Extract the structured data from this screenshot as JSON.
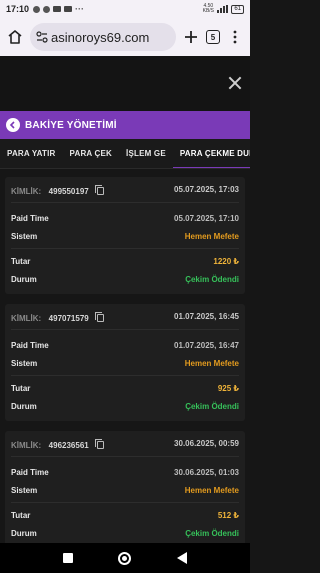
{
  "status": {
    "time": "17:10",
    "net": "4.50\nKB/S",
    "battery": "61"
  },
  "browser": {
    "url": "asinoroys69.com",
    "tab_count": "5"
  },
  "panel": {
    "title": "BAKİYE YÖNETİMİ"
  },
  "tabs": [
    {
      "label": "PARA YATIR"
    },
    {
      "label": "PARA ÇEK"
    },
    {
      "label": "İŞLEM GE"
    },
    {
      "label": "PARA ÇEKME DURUMU"
    }
  ],
  "labels": {
    "id": "KİMLİK:",
    "paid_time": "Paid Time",
    "system": "Sistem",
    "amount": "Tutar",
    "status": "Durum"
  },
  "records": [
    {
      "id": "499550197",
      "date": "05.07.2025, 17:03",
      "paid_time": "05.07.2025, 17:10",
      "system": "Hemen Mefete",
      "amount": "1220 ₺",
      "status": "Çekim Ödendi"
    },
    {
      "id": "497071579",
      "date": "01.07.2025, 16:45",
      "paid_time": "01.07.2025, 16:47",
      "system": "Hemen Mefete",
      "amount": "925 ₺",
      "status": "Çekim Ödendi"
    },
    {
      "id": "496236561",
      "date": "30.06.2025, 00:59",
      "paid_time": "30.06.2025, 01:03",
      "system": "Hemen Mefete",
      "amount": "512 ₺",
      "status": "Çekim Ödendi"
    }
  ]
}
